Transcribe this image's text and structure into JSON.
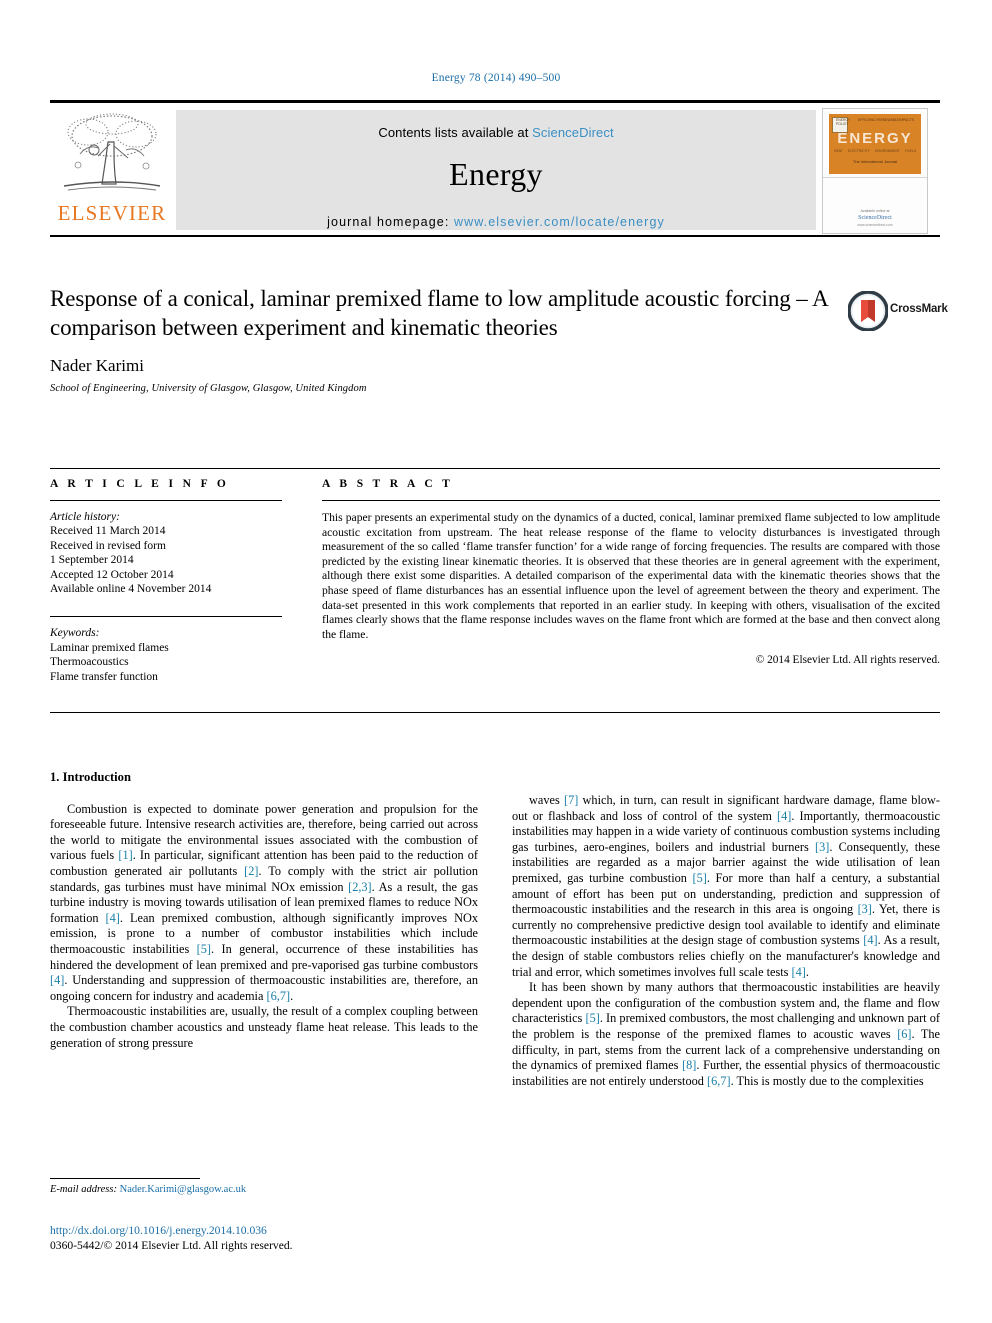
{
  "running_head": "Energy 78 (2014) 490–500",
  "masthead": {
    "contents_prefix": "Contents lists available at ",
    "sciencedirect": "ScienceDirect",
    "journal_name": "Energy",
    "homepage_prefix": "journal homepage: ",
    "homepage_url": "www.elsevier.com/locate/energy",
    "publisher_name": "ELSEVIER",
    "publisher_logo_icon": "elsevier-tree-logo",
    "cover": {
      "title": "ENERGY",
      "top_labels": [
        "ENERGY POLICY",
        "EFFICIENCY",
        "RENEWABLE",
        "IMPACTS"
      ],
      "sub_labels": [
        "HEAT",
        "ELECTRICITY",
        "ENVIRONMENT",
        "FUELS"
      ],
      "tagline": "The International Journal",
      "footer_available": "Available online at",
      "footer_brand": "ScienceDirect",
      "footer_url": "www.sciencedirect.com"
    }
  },
  "article": {
    "title": "Response of a conical, laminar premixed flame to low amplitude acoustic forcing – A comparison between experiment and kinematic theories",
    "crossmark_label": "CrossMark",
    "crossmark_icon": "crossmark-badge-icon",
    "author": "Nader Karimi",
    "affiliation": "School of Engineering, University of Glasgow, Glasgow, United Kingdom"
  },
  "article_info": {
    "heading": "A R T I C L E  I N F O",
    "history_label": "Article history:",
    "history": [
      "Received 11 March 2014",
      "Received in revised form",
      "1 September 2014",
      "Accepted 12 October 2014",
      "Available online 4 November 2014"
    ],
    "keywords_label": "Keywords:",
    "keywords": [
      "Laminar premixed flames",
      "Thermoacoustics",
      "Flame transfer function"
    ]
  },
  "abstract": {
    "heading": "A B S T R A C T",
    "text": "This paper presents an experimental study on the dynamics of a ducted, conical, laminar premixed flame subjected to low amplitude acoustic excitation from upstream. The heat release response of the flame to velocity disturbances is investigated through measurement of the so called ‘flame transfer function’ for a wide range of forcing frequencies. The results are compared with those predicted by the existing linear kinematic theories. It is observed that these theories are in general agreement with the experiment, although there exist some disparities. A detailed comparison of the experimental data with the kinematic theories shows that the phase speed of flame disturbances has an essential influence upon the level of agreement between the theory and experiment. The data-set presented in this work complements that reported in an earlier study. In keeping with others, visualisation of the excited flames clearly shows that the flame response includes waves on the flame front which are formed at the base and then convect along the flame.",
    "copyright": "© 2014 Elsevier Ltd. All rights reserved."
  },
  "introduction": {
    "section_title": "1. Introduction",
    "left_paragraphs": [
      "Combustion is expected to dominate power generation and propulsion for the foreseeable future. Intensive research activities are, therefore, being carried out across the world to mitigate the environmental issues associated with the combustion of various fuels [1]. In particular, significant attention has been paid to the reduction of combustion generated air pollutants [2]. To comply with the strict air pollution standards, gas turbines must have minimal NOx emission [2,3]. As a result, the gas turbine industry is moving towards utilisation of lean premixed flames to reduce NOx formation [4]. Lean premixed combustion, although significantly improves NOx emission, is prone to a number of combustor instabilities which include thermoacoustic instabilities [5]. In general, occurrence of these instabilities has hindered the development of lean premixed and pre-vaporised gas turbine combustors [4]. Understanding and suppression of thermoacoustic instabilities are, therefore, an ongoing concern for industry and academia [6,7].",
      "Thermoacoustic instabilities are, usually, the result of a complex coupling between the combustion chamber acoustics and unsteady flame heat release. This leads to the generation of strong pressure"
    ],
    "right_paragraphs": [
      "waves [7] which, in turn, can result in significant hardware damage, flame blow-out or flashback and loss of control of the system [4]. Importantly, thermoacoustic instabilities may happen in a wide variety of continuous combustion systems including gas turbines, aero-engines, boilers and industrial burners [3]. Consequently, these instabilities are regarded as a major barrier against the wide utilisation of lean premixed, gas turbine combustion [5]. For more than half a century, a substantial amount of effort has been put on understanding, prediction and suppression of thermoacoustic instabilities and the research in this area is ongoing [3]. Yet, there is currently no comprehensive predictive design tool available to identify and eliminate thermoacoustic instabilities at the design stage of combustion systems [4]. As a result, the design of stable combustors relies chiefly on the manufacturer's knowledge and trial and error, which sometimes involves full scale tests [4].",
      "It has been shown by many authors that thermoacoustic instabilities are heavily dependent upon the configuration of the combustion system and, the flame and flow characteristics [5]. In premixed combustors, the most challenging and unknown part of the problem is the response of the premixed flames to acoustic waves [6]. The difficulty, in part, stems from the current lack of a comprehensive understanding on the dynamics of premixed flames [8]. Further, the essential physics of thermoacoustic instabilities are not entirely understood [6,7]. This is mostly due to the complexities"
    ]
  },
  "footer": {
    "email_label": "E-mail address:",
    "email": "Nader.Karimi@glasgow.ac.uk",
    "doi_url": "http://dx.doi.org/10.1016/j.energy.2014.10.036",
    "issn_line": "0360-5442/© 2014 Elsevier Ltd. All rights reserved."
  },
  "colors": {
    "link_blue": "#1a6fa8",
    "citation_teal": "#1a7fa8",
    "elsevier_orange": "#e87722",
    "panel_grey": "#e3e3e3",
    "cover_orange": "#d98327"
  }
}
